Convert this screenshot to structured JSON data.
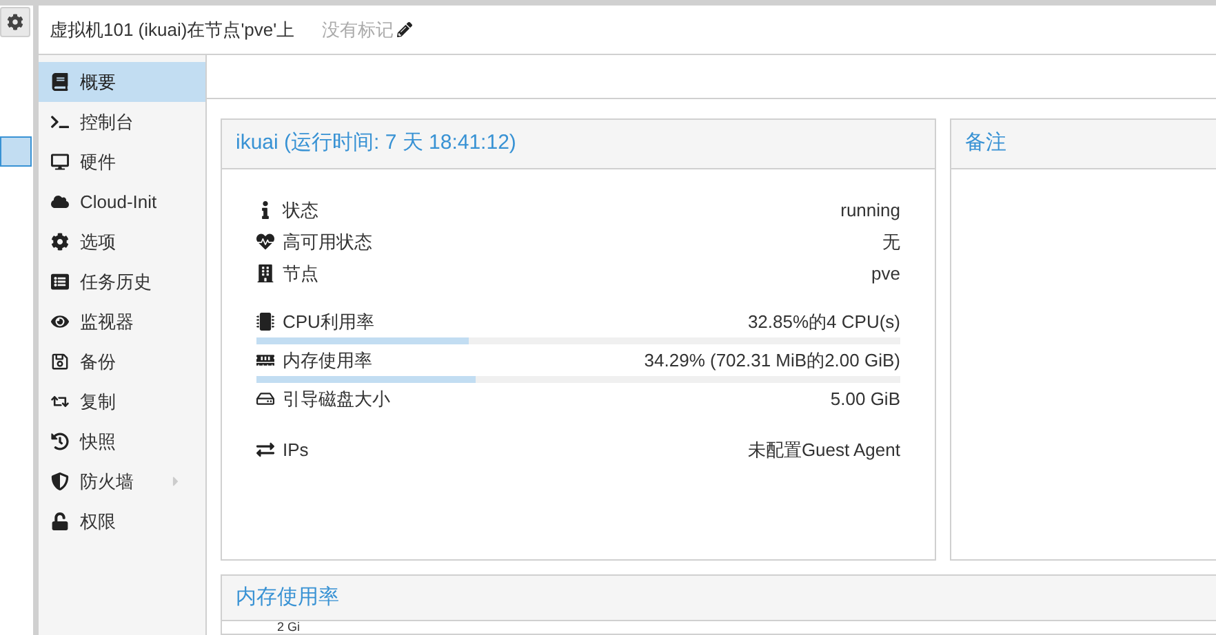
{
  "header": {
    "title": "虚拟机101 (ikuai)在节点'pve'上",
    "tags": "没有标记"
  },
  "sidebar": {
    "items": [
      {
        "label": "概要",
        "selected": true,
        "expandable": false
      },
      {
        "label": "控制台",
        "selected": false,
        "expandable": false
      },
      {
        "label": "硬件",
        "selected": false,
        "expandable": false
      },
      {
        "label": "Cloud-Init",
        "selected": false,
        "expandable": false
      },
      {
        "label": "选项",
        "selected": false,
        "expandable": false
      },
      {
        "label": "任务历史",
        "selected": false,
        "expandable": false
      },
      {
        "label": "监视器",
        "selected": false,
        "expandable": false
      },
      {
        "label": "备份",
        "selected": false,
        "expandable": false
      },
      {
        "label": "复制",
        "selected": false,
        "expandable": false
      },
      {
        "label": "快照",
        "selected": false,
        "expandable": false
      },
      {
        "label": "防火墙",
        "selected": false,
        "expandable": true
      },
      {
        "label": "权限",
        "selected": false,
        "expandable": false
      }
    ]
  },
  "status_panel": {
    "title": "ikuai (运行时间: 7 天 18:41:12)",
    "rows": [
      {
        "kind": "field",
        "label": "状态",
        "value": "running"
      },
      {
        "kind": "field",
        "label": "高可用状态",
        "value": "无"
      },
      {
        "kind": "field",
        "label": "节点",
        "value": "pve"
      },
      {
        "kind": "meter",
        "label": "CPU利用率",
        "value": "32.85%的4 CPU(s)",
        "level": 0.33
      },
      {
        "kind": "meter",
        "label": "内存使用率",
        "value": "34.29% (702.31 MiB的2.00 GiB)",
        "level": 0.34
      },
      {
        "kind": "field",
        "label": "引导磁盘大小",
        "value": "5.00 GiB"
      },
      {
        "kind": "field",
        "label": "IPs",
        "value": "未配置Guest Agent"
      }
    ]
  },
  "notes_panel": {
    "title": "备注"
  },
  "memory_panel": {
    "title": "内存使用率",
    "axis_label": "2 Gi"
  }
}
